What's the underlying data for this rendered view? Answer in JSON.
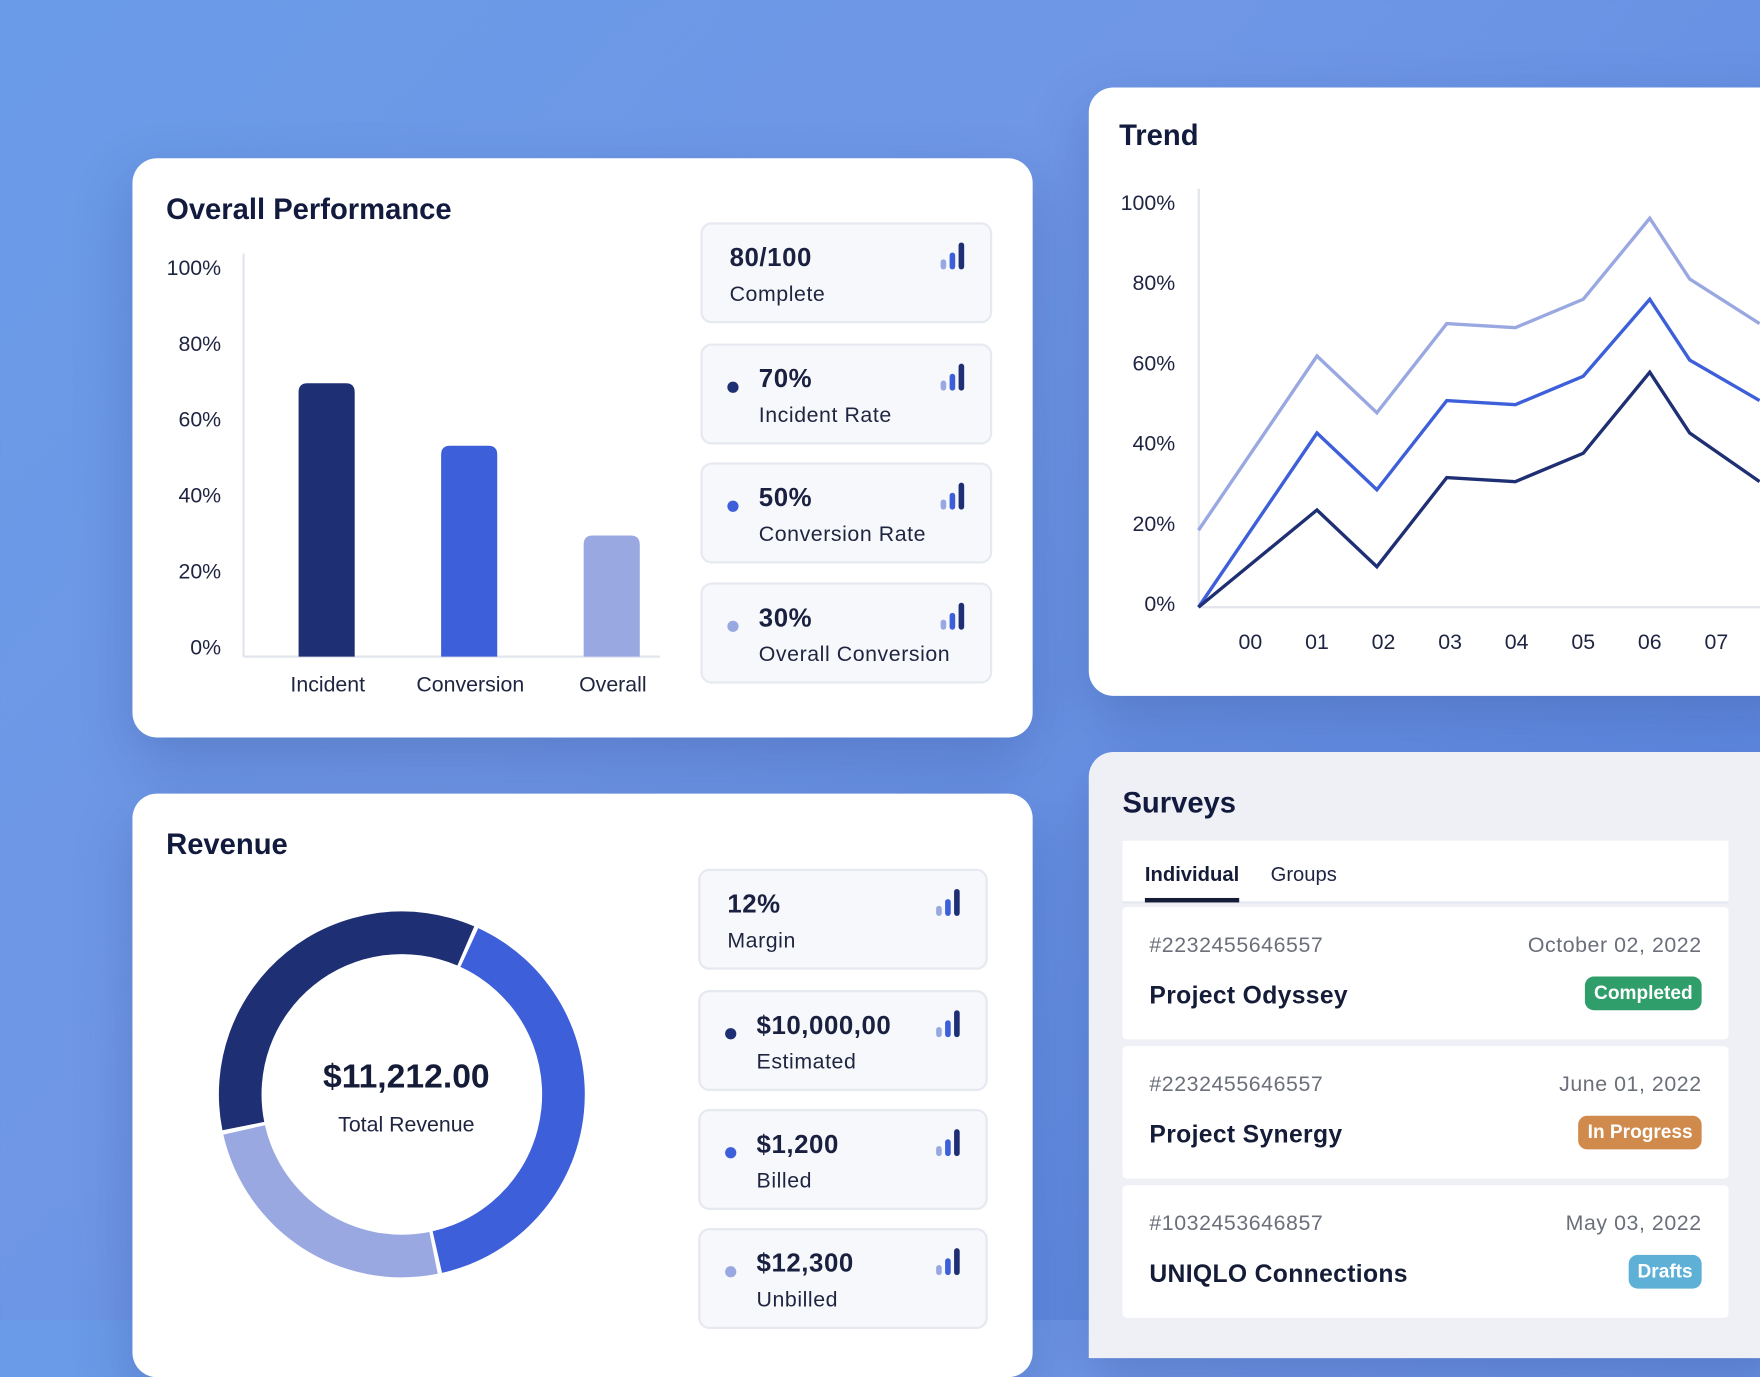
{
  "colors": {
    "dark": "#1f2f73",
    "mid": "#3d5fd9",
    "light": "#9aa8e2"
  },
  "performance": {
    "title": "Overall Performance",
    "chart_data": {
      "type": "bar",
      "categories": [
        "Incident",
        "Conversion",
        "Overall"
      ],
      "values": [
        70,
        54,
        31
      ],
      "yticks": [
        "100%",
        "80%",
        "60%",
        "40%",
        "20%",
        "0%"
      ],
      "ylim": [
        0,
        100
      ],
      "colors": [
        "#1f2f73",
        "#3d5fd9",
        "#9aa8e2"
      ]
    },
    "stats": [
      {
        "value": "80/100",
        "label": "Complete",
        "dot": ""
      },
      {
        "value": "70%",
        "label": "Incident Rate",
        "dot": "#1f2f73"
      },
      {
        "value": "50%",
        "label": "Conversion Rate",
        "dot": "#3d5fd9"
      },
      {
        "value": "30%",
        "label": "Overall Conversion",
        "dot": "#9aa8e2"
      }
    ],
    "stat_icon": "signal-bars-icon"
  },
  "trend": {
    "title": "Trend",
    "chart_data": {
      "type": "line",
      "xticks": [
        "00",
        "01",
        "02",
        "03",
        "04",
        "05",
        "06",
        "07"
      ],
      "yticks": [
        "100%",
        "80%",
        "60%",
        "40%",
        "20%",
        "0%"
      ],
      "ylim": [
        0,
        100
      ],
      "x": [
        -0.78,
        1.0,
        1.9,
        2.95,
        3.98,
        5.0,
        6.0,
        6.6,
        7.65
      ],
      "series": [
        {
          "color": "#9aa8e2",
          "values": [
            19,
            62,
            48,
            70,
            69,
            76,
            96,
            81,
            70
          ]
        },
        {
          "color": "#3d5fd9",
          "values": [
            0,
            43,
            29,
            51,
            50,
            57,
            76,
            61,
            51
          ]
        },
        {
          "color": "#1f2f73",
          "values": [
            0,
            24,
            10,
            32,
            31,
            38,
            58,
            43,
            31
          ]
        }
      ]
    }
  },
  "revenue": {
    "title": "Revenue",
    "total": "$11,212.00",
    "total_label": "Total Revenue",
    "chart_data": {
      "type": "pie",
      "values": [
        35,
        40,
        25
      ],
      "colors": [
        "#1f2f73",
        "#3d5fd9",
        "#9aa8e2"
      ]
    },
    "stats": [
      {
        "value": "12%",
        "label": "Margin",
        "dot": ""
      },
      {
        "value": "$10,000,00",
        "label": "Estimated",
        "dot": "#1f2f73"
      },
      {
        "value": "$1,200",
        "label": "Billed",
        "dot": "#3d5fd9"
      },
      {
        "value": "$12,300",
        "label": "Unbilled",
        "dot": "#9aa8e2"
      }
    ]
  },
  "surveys": {
    "title": "Surveys",
    "tabs": [
      {
        "label": "Individual",
        "active": true
      },
      {
        "label": "Groups",
        "active": false
      }
    ],
    "rows": [
      {
        "id": "#2232455646557",
        "date": "October 02, 2022",
        "name": "Project Odyssey",
        "status": "Completed",
        "color": "#2f9e6a"
      },
      {
        "id": "#2232455646557",
        "date": "June 01, 2022",
        "name": "Project Synergy",
        "status": "In Progress",
        "color": "#cf8a4c"
      },
      {
        "id": "#1032453646857",
        "date": "May 03, 2022",
        "name": "UNIQLO Connections",
        "status": "Drafts",
        "color": "#5fb0d6"
      }
    ]
  }
}
